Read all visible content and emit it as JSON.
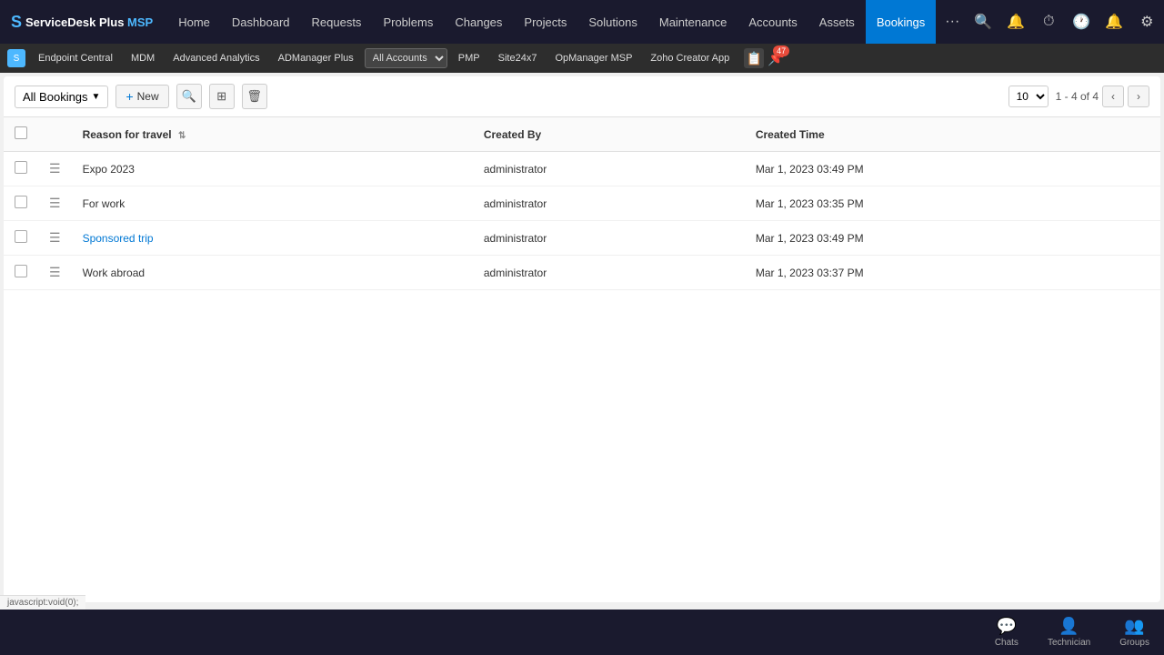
{
  "app": {
    "name": "ServiceDesk Plus MSP",
    "logo_text": "ServiceDesk Plus ",
    "logo_msp": "MSP"
  },
  "top_nav": {
    "items": [
      {
        "label": "Home",
        "active": false
      },
      {
        "label": "Dashboard",
        "active": false
      },
      {
        "label": "Requests",
        "active": false
      },
      {
        "label": "Problems",
        "active": false
      },
      {
        "label": "Changes",
        "active": false
      },
      {
        "label": "Projects",
        "active": false
      },
      {
        "label": "Solutions",
        "active": false
      },
      {
        "label": "Maintenance",
        "active": false
      },
      {
        "label": "Accounts",
        "active": false
      },
      {
        "label": "Assets",
        "active": false
      },
      {
        "label": "Bookings",
        "active": true
      }
    ],
    "more_label": "···"
  },
  "sub_nav": {
    "items": [
      {
        "label": "Endpoint Central"
      },
      {
        "label": "MDM"
      },
      {
        "label": "Advanced Analytics"
      },
      {
        "label": "ADManager Plus"
      },
      {
        "label": "All Accounts"
      },
      {
        "label": "PMP"
      },
      {
        "label": "Site24x7"
      },
      {
        "label": "OpManager MSP"
      },
      {
        "label": "Zoho Creator App"
      }
    ],
    "badge_count": "47"
  },
  "toolbar": {
    "booking_filter": "All Bookings",
    "new_label": "New",
    "page_size": "10",
    "pagination_text": "1 - 4 of 4"
  },
  "table": {
    "columns": [
      {
        "id": "checkbox",
        "label": ""
      },
      {
        "id": "menu",
        "label": ""
      },
      {
        "id": "reason",
        "label": "Reason for travel"
      },
      {
        "id": "created_by",
        "label": "Created By"
      },
      {
        "id": "created_time",
        "label": "Created Time"
      }
    ],
    "rows": [
      {
        "checkbox": false,
        "reason": "Expo 2023",
        "reason_link": false,
        "created_by": "administrator",
        "created_time": "Mar 1, 2023 03:49 PM"
      },
      {
        "checkbox": false,
        "reason": "For work",
        "reason_link": false,
        "created_by": "administrator",
        "created_time": "Mar 1, 2023 03:35 PM"
      },
      {
        "checkbox": false,
        "reason": "Sponsored trip",
        "reason_link": true,
        "created_by": "administrator",
        "created_time": "Mar 1, 2023 03:49 PM"
      },
      {
        "checkbox": false,
        "reason": "Work abroad",
        "reason_link": false,
        "created_by": "administrator",
        "created_time": "Mar 1, 2023 03:37 PM"
      }
    ]
  },
  "bottom_bar": {
    "items": [
      {
        "label": "Chats",
        "icon": "💬"
      },
      {
        "label": "Technician",
        "icon": "👤"
      },
      {
        "label": "Groups",
        "icon": "👥"
      }
    ]
  },
  "status_bar": {
    "text": "javascript:void(0);"
  }
}
